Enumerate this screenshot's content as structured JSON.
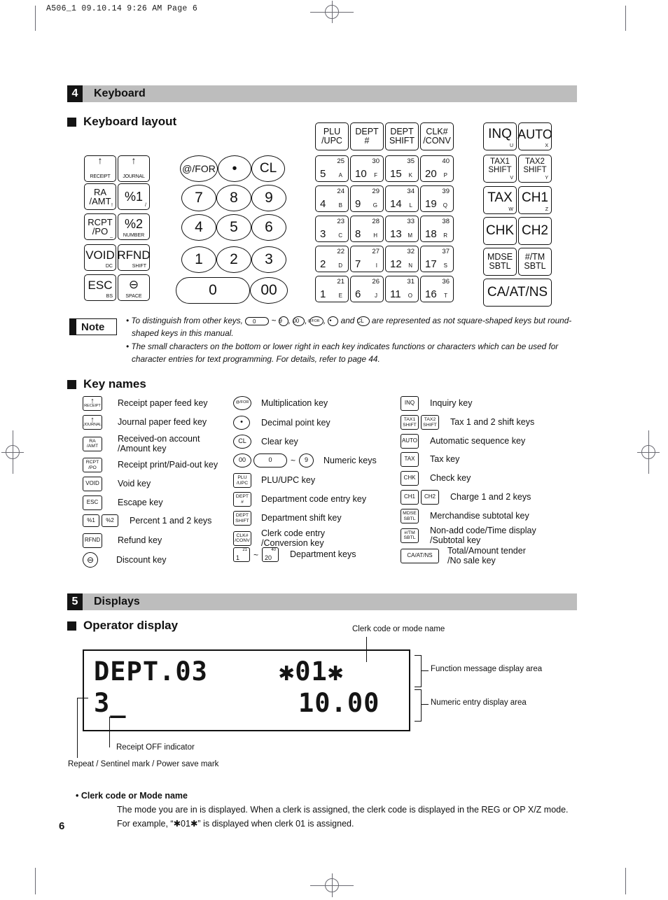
{
  "print_header": "A506_1  09.10.14 9:26 AM  Page 6",
  "page_number": "6",
  "sections": {
    "keyboard": {
      "num": "4",
      "title": "Keyboard"
    },
    "displays": {
      "num": "5",
      "title": "Displays"
    }
  },
  "subheads": {
    "keyboard_layout": "Keyboard layout",
    "key_names": "Key names",
    "operator_display": "Operator display"
  },
  "keyboard": {
    "left_block": [
      {
        "name": "receipt-feed",
        "main": "↑",
        "label2": "RECEIPT",
        "sub": ""
      },
      {
        "name": "journal-feed",
        "main": "↑",
        "label2": "JOURNAL",
        "sub": ""
      },
      {
        "name": "ra-amt",
        "main": "RA\n/AMT",
        "sub": "!"
      },
      {
        "name": "percent1",
        "main": "%1",
        "sub": "/"
      },
      {
        "name": "rcpt-po",
        "main": "RCPT\n/PO",
        "sub": "_"
      },
      {
        "name": "percent2",
        "main": "%2",
        "sub": "NUMBER"
      },
      {
        "name": "void",
        "main": "VOID",
        "sub": "DC"
      },
      {
        "name": "rfnd",
        "main": "RFND",
        "sub": "SHIFT"
      },
      {
        "name": "esc",
        "main": "ESC",
        "sub": "BS"
      },
      {
        "name": "discount",
        "main": "⊖",
        "sub": "SPACE"
      }
    ],
    "numpad": [
      {
        "name": "at-for",
        "label": "@/FOR"
      },
      {
        "name": "decimal-point",
        "label": "•"
      },
      {
        "name": "clear",
        "label": "CL"
      },
      {
        "name": "num-7",
        "label": "7"
      },
      {
        "name": "num-8",
        "label": "8"
      },
      {
        "name": "num-9",
        "label": "9"
      },
      {
        "name": "num-4",
        "label": "4"
      },
      {
        "name": "num-5",
        "label": "5"
      },
      {
        "name": "num-6",
        "label": "6"
      },
      {
        "name": "num-1",
        "label": "1"
      },
      {
        "name": "num-2",
        "label": "2"
      },
      {
        "name": "num-3",
        "label": "3"
      },
      {
        "name": "num-0",
        "label": "0"
      },
      {
        "name": "num-00",
        "label": "00"
      }
    ],
    "dept_top_row": [
      {
        "name": "plu-upc",
        "label": "PLU\n/UPC"
      },
      {
        "name": "dept-num",
        "label": "DEPT\n#"
      },
      {
        "name": "dept-shift",
        "label": "DEPT\nSHIFT"
      },
      {
        "name": "clk-conv",
        "label": "CLK#\n/CONV"
      }
    ],
    "dept_grid": [
      [
        {
          "top": "25",
          "bottom": "5",
          "char": "A"
        },
        {
          "top": "30",
          "bottom": "10",
          "char": "F"
        },
        {
          "top": "35",
          "bottom": "15",
          "char": "K"
        },
        {
          "top": "40",
          "bottom": "20",
          "char": "P"
        }
      ],
      [
        {
          "top": "24",
          "bottom": "4",
          "char": "B"
        },
        {
          "top": "29",
          "bottom": "9",
          "char": "G"
        },
        {
          "top": "34",
          "bottom": "14",
          "char": "L"
        },
        {
          "top": "39",
          "bottom": "19",
          "char": "Q"
        }
      ],
      [
        {
          "top": "23",
          "bottom": "3",
          "char": "C"
        },
        {
          "top": "28",
          "bottom": "8",
          "char": "H"
        },
        {
          "top": "33",
          "bottom": "13",
          "char": "M"
        },
        {
          "top": "38",
          "bottom": "18",
          "char": "R"
        }
      ],
      [
        {
          "top": "22",
          "bottom": "2",
          "char": "D"
        },
        {
          "top": "27",
          "bottom": "7",
          "char": "I"
        },
        {
          "top": "32",
          "bottom": "12",
          "char": "N"
        },
        {
          "top": "37",
          "bottom": "17",
          "char": "S"
        }
      ],
      [
        {
          "top": "21",
          "bottom": "1",
          "char": "E"
        },
        {
          "top": "26",
          "bottom": "6",
          "char": "J"
        },
        {
          "top": "31",
          "bottom": "11",
          "char": "O"
        },
        {
          "top": "36",
          "bottom": "16",
          "char": "T"
        }
      ]
    ],
    "right_block": [
      {
        "name": "inq",
        "main": "INQ",
        "sub": "U",
        "size": "lg"
      },
      {
        "name": "auto",
        "main": "AUTO",
        "sub": "X",
        "size": "lg"
      },
      {
        "name": "tax1-shift",
        "main": "TAX1\nSHIFT",
        "sub": "V",
        "size": "sm"
      },
      {
        "name": "tax2-shift",
        "main": "TAX2\nSHIFT",
        "sub": "Y",
        "size": "sm"
      },
      {
        "name": "tax",
        "main": "TAX",
        "sub": "W",
        "size": "lg"
      },
      {
        "name": "ch1",
        "main": "CH1",
        "sub": "Z",
        "size": "lg"
      },
      {
        "name": "chk",
        "main": "CHK",
        "sub": "",
        "size": "lg"
      },
      {
        "name": "ch2",
        "main": "CH2",
        "sub": "",
        "size": "lg"
      },
      {
        "name": "mdse-sbtl",
        "main": "MDSE\nSBTL",
        "sub": "",
        "size": "sm"
      },
      {
        "name": "tm-sbtl",
        "main": "#/TM\nSBTL",
        "sub": "",
        "size": "sm"
      }
    ],
    "ca_at_ns": "CA/AT/NS"
  },
  "note": {
    "badge": "Note",
    "line1_a": "• To distinguish from other keys, ",
    "line1_key0": "0",
    "line1_tilde": " ~ ",
    "line1_key9": "9",
    "line1_b": ", ",
    "line1_key00": "00",
    "line1_c": ", ",
    "line1_keyat": "@/FOR",
    "line1_d": ", ",
    "line1_keydot": "•",
    "line1_e": " and ",
    "line1_keycl": "CL",
    "line1_f": " are represented as not square-shaped keys but round-shaped keys in this manual.",
    "line2": "• The small characters on the bottom or lower right in each key indicates functions or characters which can be used for character entries for text programming.  For details, refer to page 44."
  },
  "key_names": {
    "col1": [
      {
        "icons": [
          {
            "type": "arrow",
            "main": "↑",
            "sub": "RECEIPT"
          }
        ],
        "text": "Receipt paper feed key"
      },
      {
        "icons": [
          {
            "type": "arrow",
            "main": "↑",
            "sub": "JOURNAL"
          }
        ],
        "text": "Journal paper feed key"
      },
      {
        "icons": [
          {
            "type": "sq",
            "label": "RA\n/AMT"
          }
        ],
        "text": "Received-on account\n/Amount key"
      },
      {
        "icons": [
          {
            "type": "sq",
            "label": "RCPT\n/PO"
          }
        ],
        "text": "Receipt print/Paid-out key"
      },
      {
        "icons": [
          {
            "type": "sq",
            "label": "VOID"
          }
        ],
        "text": "Void key"
      },
      {
        "icons": [
          {
            "type": "sq",
            "label": "ESC"
          }
        ],
        "text": "Escape key"
      },
      {
        "icons": [
          {
            "type": "sq",
            "label": "%1"
          },
          {
            "type": "sq",
            "label": "%2"
          }
        ],
        "text": "Percent 1 and 2 keys"
      },
      {
        "icons": [
          {
            "type": "sq",
            "label": "RFND"
          }
        ],
        "text": "Refund key"
      },
      {
        "icons": [
          {
            "type": "rnd",
            "label": "⊖"
          }
        ],
        "text": "Discount key"
      }
    ],
    "col2": [
      {
        "icons": [
          {
            "type": "rnd",
            "label": "@/FOR"
          }
        ],
        "text": "Multiplication key"
      },
      {
        "icons": [
          {
            "type": "rnd",
            "label": "•"
          }
        ],
        "text": "Decimal point key"
      },
      {
        "icons": [
          {
            "type": "rnd",
            "label": "CL"
          }
        ],
        "text": "Clear key"
      },
      {
        "icons": [
          {
            "type": "rnd",
            "label": "00"
          },
          {
            "type": "pil",
            "label": "0"
          },
          {
            "type": "tilde",
            "label": "~"
          },
          {
            "type": "rnd",
            "label": "9"
          }
        ],
        "text": "Numeric keys"
      },
      {
        "icons": [
          {
            "type": "sq",
            "label": "PLU\n/UPC"
          }
        ],
        "text": "PLU/UPC key"
      },
      {
        "icons": [
          {
            "type": "sq",
            "label": "DEPT\n#"
          }
        ],
        "text": "Department code entry key"
      },
      {
        "icons": [
          {
            "type": "sq",
            "label": "DEPT\nSHIFT"
          }
        ],
        "text": "Department shift key"
      },
      {
        "icons": [
          {
            "type": "sq",
            "label": "CLK#\n/CONV"
          }
        ],
        "text": "Clerk code entry\n/Conversion key"
      },
      {
        "icons": [
          {
            "type": "dept",
            "top": "21",
            "bottom": "1"
          },
          {
            "type": "tilde",
            "label": "~"
          },
          {
            "type": "dept",
            "top": "40",
            "bottom": "20"
          }
        ],
        "text": "Department keys"
      }
    ],
    "col3": [
      {
        "icons": [
          {
            "type": "sq",
            "label": "INQ"
          }
        ],
        "text": "Inquiry key"
      },
      {
        "icons": [
          {
            "type": "sq",
            "label": "TAX1\nSHIFT"
          },
          {
            "type": "sq",
            "label": "TAX2\nSHIFT"
          }
        ],
        "text": "Tax 1 and 2 shift keys"
      },
      {
        "icons": [
          {
            "type": "sq",
            "label": "AUTO"
          }
        ],
        "text": "Automatic sequence key"
      },
      {
        "icons": [
          {
            "type": "sq",
            "label": "TAX"
          }
        ],
        "text": "Tax key"
      },
      {
        "icons": [
          {
            "type": "sq",
            "label": "CHK"
          }
        ],
        "text": "Check key"
      },
      {
        "icons": [
          {
            "type": "sq",
            "label": "CH1"
          },
          {
            "type": "sq",
            "label": "CH2"
          }
        ],
        "text": "Charge 1 and 2 keys"
      },
      {
        "icons": [
          {
            "type": "sq",
            "label": "MDSE\nSBTL"
          }
        ],
        "text": "Merchandise subtotal key"
      },
      {
        "icons": [
          {
            "type": "sq",
            "label": "#/TM\nSBTL"
          }
        ],
        "text": "Non-add code/Time display\n/Subtotal key"
      },
      {
        "icons": [
          {
            "type": "wide",
            "label": "CA/AT/NS"
          }
        ],
        "text": "Total/Amount tender\n/No sale key"
      }
    ]
  },
  "display": {
    "row1_left": "DEPT.03",
    "row1_right": "✱01✱",
    "row2_left": "3_",
    "row2_right": "10.00",
    "callouts": {
      "clerk_code": "Clerk code or mode name",
      "function_area": "Function message display area",
      "numeric_area": "Numeric entry display area",
      "receipt_off": "Receipt OFF indicator",
      "repeat_sentinel": "Repeat / Sentinel mark / Power save mark"
    }
  },
  "explain": {
    "heading": "• Clerk code or Mode name",
    "body": "The mode you are in is displayed.  When a clerk is assigned, the clerk code is displayed in the REG or OP X/Z mode.  For example, “✱01✱” is displayed when clerk 01 is assigned."
  }
}
